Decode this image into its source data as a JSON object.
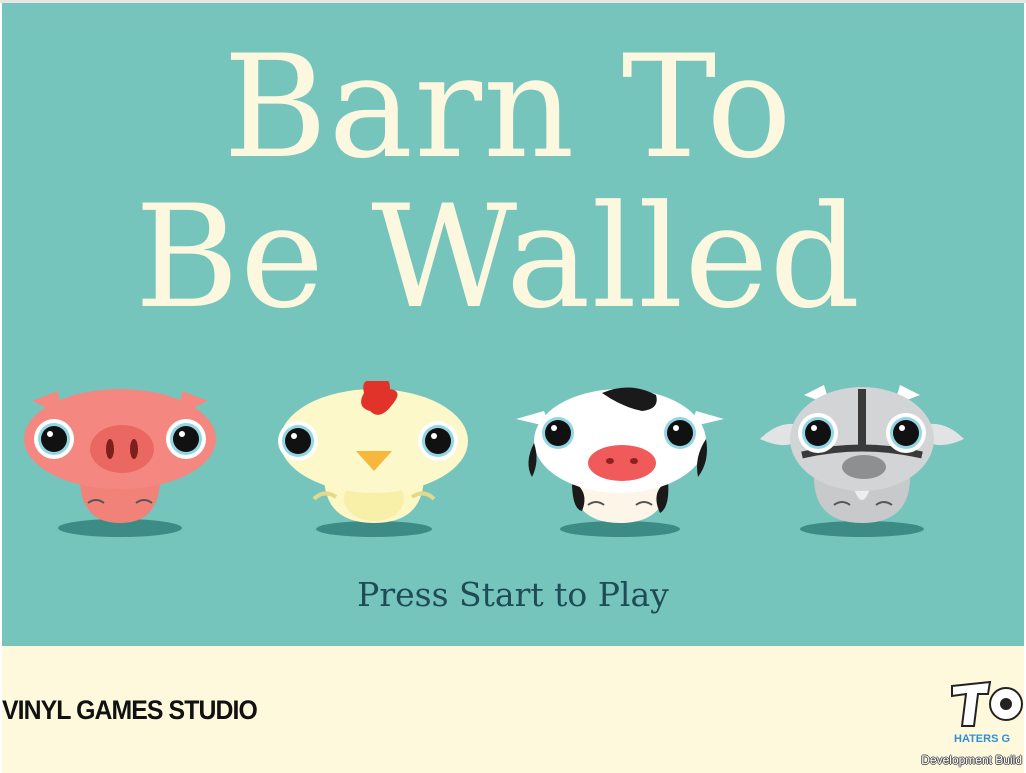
{
  "game": {
    "title_line1": "Barn To",
    "title_line2": "Be Walled",
    "prompt": "Press Start to Play",
    "studio": "VINYL GAMES STUDIO",
    "logo_text": "HATERS G",
    "build_label": "Development Build"
  },
  "characters": [
    "pig",
    "chicken",
    "cow",
    "goat"
  ],
  "colors": {
    "background": "#76c5bd",
    "title": "#fcf8df",
    "prompt": "#1f4b57",
    "footer": "#fef8dc"
  }
}
